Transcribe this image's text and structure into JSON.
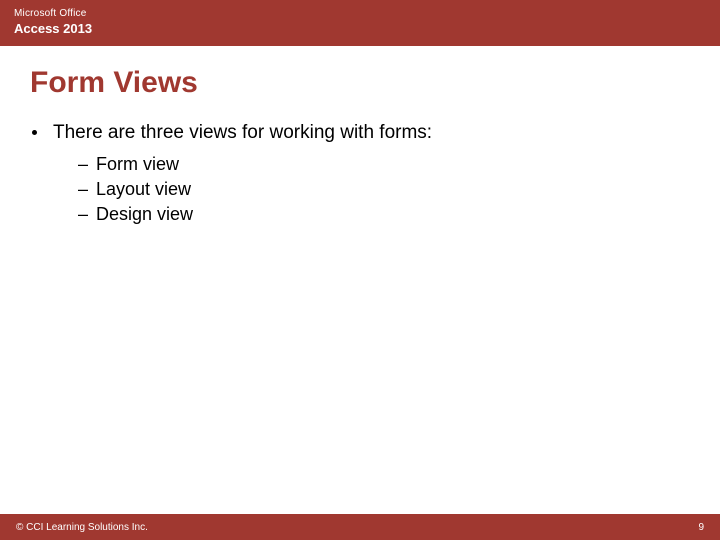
{
  "header": {
    "brand": "Microsoft Office",
    "product": "Access 2013"
  },
  "title": "Form Views",
  "main_bullet": "There are three views for working with forms:",
  "sub_bullets": [
    "Form view",
    "Layout view",
    "Design view"
  ],
  "footer": {
    "copyright": "© CCI Learning Solutions Inc.",
    "page": "9"
  }
}
